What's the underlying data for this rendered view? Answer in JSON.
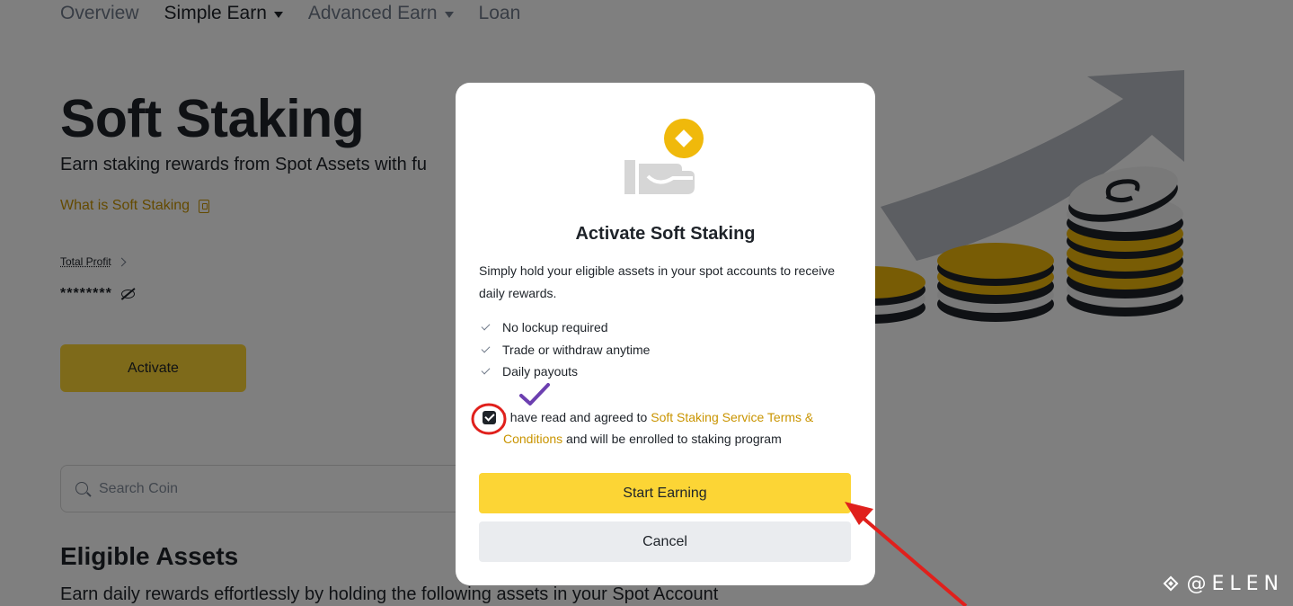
{
  "nav": {
    "items": [
      {
        "label": "Overview"
      },
      {
        "label": "Simple Earn"
      },
      {
        "label": "Advanced Earn"
      },
      {
        "label": "Loan"
      }
    ]
  },
  "hero": {
    "title": "Soft Staking",
    "subtitle": "Earn staking rewards from Spot Assets with fu",
    "what_link": "What is Soft Staking",
    "total_profit_label": "Total Profit",
    "total_profit_value": "********",
    "activate_label": "Activate"
  },
  "search": {
    "placeholder": "Search Coin"
  },
  "eligible": {
    "title": "Eligible Assets",
    "subtitle": "Earn daily rewards effortlessly by holding the following assets in your Spot Account"
  },
  "modal": {
    "title": "Activate Soft Staking",
    "description": "Simply hold your eligible assets in your spot accounts to receive daily rewards.",
    "features": [
      "No lockup required",
      "Trade or withdraw anytime",
      "Daily payouts"
    ],
    "agree_prefix": "I have read and agreed to",
    "agree_link_part1": "Soft Staking Service Terms &",
    "agree_link_part2": "Conditions",
    "agree_suffix": "and will be enrolled to staking program",
    "agree_checked": true,
    "start_label": "Start Earning",
    "cancel_label": "Cancel"
  },
  "watermark": "@ELEN",
  "colors": {
    "accent": "#fcd535",
    "link": "#c99400",
    "annotation_red": "#e0201c",
    "annotation_purple": "#6c3fb0"
  }
}
